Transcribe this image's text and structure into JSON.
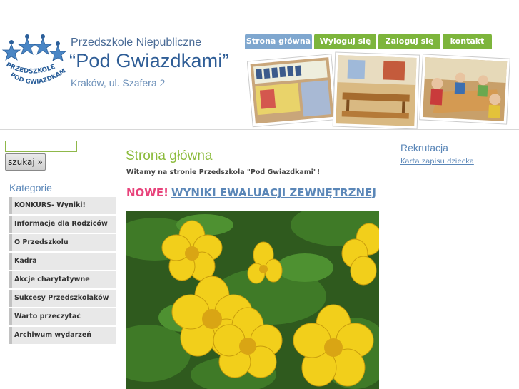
{
  "header": {
    "site_name": "Przedszkole Niepubliczne",
    "site_title": "“Pod Gwiazdkami”",
    "address": "Kraków, ul. Szafera 2",
    "logo_text_line1": "PRZEDSZKOLE",
    "logo_text_line2": "POD GWIAZDKAMI"
  },
  "nav": {
    "tabs": [
      {
        "label": "Strona główna",
        "active": true
      },
      {
        "label": "Wyloguj się",
        "active": false
      },
      {
        "label": "Zaloguj się",
        "active": false
      },
      {
        "label": "kontakt",
        "active": false
      }
    ]
  },
  "search": {
    "value": "",
    "button_label": "szukaj »"
  },
  "categories": {
    "heading": "Kategorie",
    "items": [
      "KONKURS- Wyniki!",
      "Informacje dla Rodziców",
      "O Przedszkolu",
      "Kadra",
      "Akcje charytatywne",
      "Sukcesy Przedszkolaków",
      "Warto przeczytać",
      "Archiwum wydarzeń"
    ]
  },
  "main": {
    "heading": "Strona główna",
    "welcome": "Witamy na stronie Przedszkola \"Pod Gwiazdkami\"!",
    "news_new": "NOWE!",
    "news_link": "WYNIKI EWALUACJI ZEWNĘTRZNEJ"
  },
  "sidebar_right": {
    "heading": "Rekrutacja",
    "link": "Karta zapisu dziecka"
  },
  "colors": {
    "green_accent": "#8cbb3c",
    "blue_accent": "#5b87b8",
    "pink_new": "#e8437b",
    "tab_active": "#7fa7cf",
    "tab_green": "#7db53c"
  }
}
